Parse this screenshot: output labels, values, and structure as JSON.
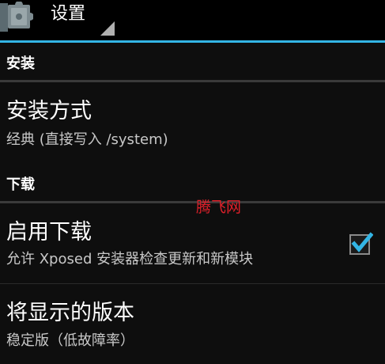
{
  "action_bar": {
    "title": "设置",
    "icon": "puzzle-piece-icon",
    "accent_color": "#33b5e5"
  },
  "sections": [
    {
      "header": "安装",
      "items": [
        {
          "title": "安装方式",
          "summary": "经典 (直接写入 /system)"
        }
      ]
    },
    {
      "header": "下载",
      "items": [
        {
          "title": "启用下载",
          "summary": "允许 Xposed 安装器检查更新和新模块",
          "checked": true
        },
        {
          "title": "将显示的版本",
          "summary": "稳定版（低故障率）"
        }
      ]
    }
  ],
  "watermark": "腾飞网"
}
